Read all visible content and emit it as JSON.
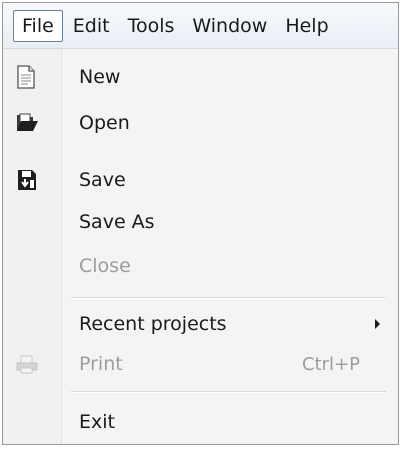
{
  "menubar": {
    "items": [
      {
        "label": "File"
      },
      {
        "label": "Edit"
      },
      {
        "label": "Tools"
      },
      {
        "label": "Window"
      },
      {
        "label": "Help"
      }
    ]
  },
  "file_menu": {
    "new": {
      "label": "New",
      "icon": "new-document-icon"
    },
    "open": {
      "label": "Open",
      "icon": "open-folder-icon"
    },
    "save": {
      "label": "Save",
      "icon": "save-icon"
    },
    "save_as": {
      "label": "Save As"
    },
    "close": {
      "label": "Close",
      "disabled": true
    },
    "recent_projects": {
      "label": "Recent projects",
      "has_submenu": true
    },
    "print": {
      "label": "Print",
      "shortcut": "Ctrl+P",
      "disabled": true,
      "icon": "printer-icon"
    },
    "exit": {
      "label": "Exit"
    }
  }
}
